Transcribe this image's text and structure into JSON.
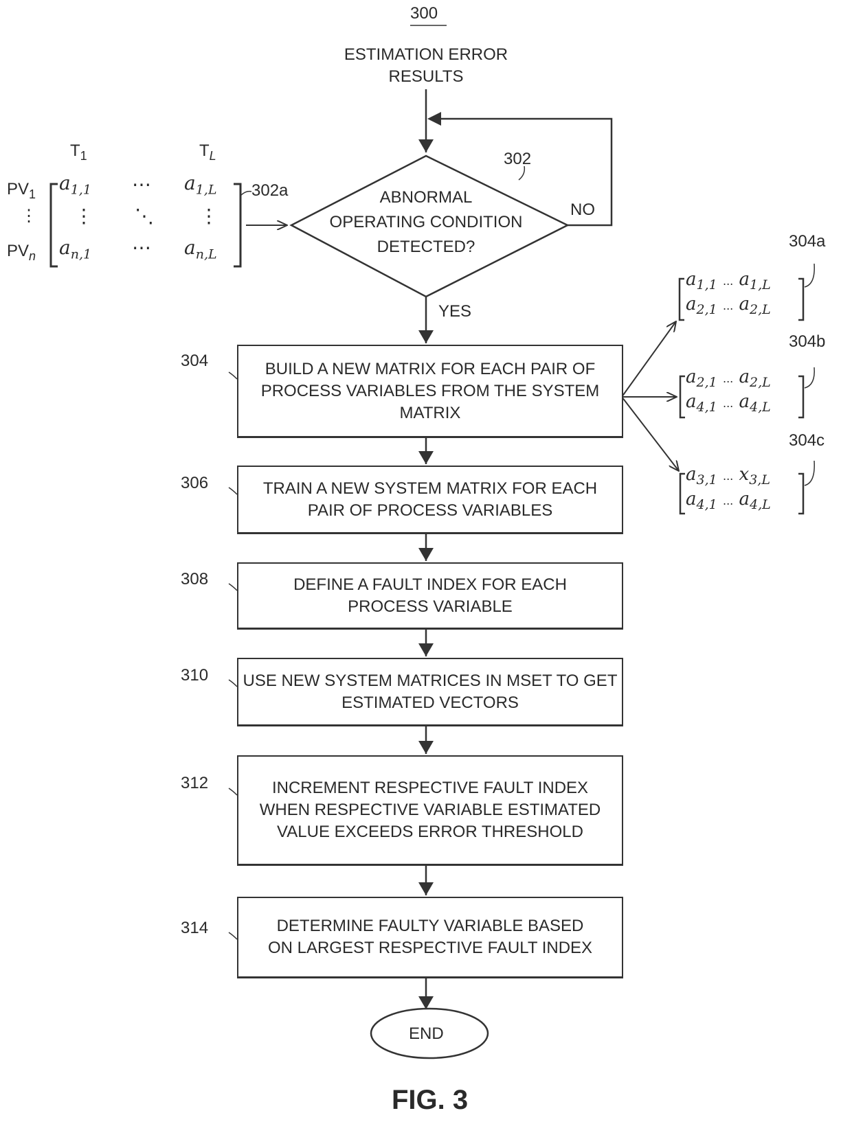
{
  "figure": {
    "ref_number": "300",
    "caption": "FIG. 3"
  },
  "start": {
    "label_line1": "ESTIMATION ERROR",
    "label_line2": "RESULTS"
  },
  "decision": {
    "ref": "302",
    "line1": "ABNORMAL",
    "line2": "OPERATING CONDITION",
    "line3": "DETECTED?",
    "no_label": "NO",
    "yes_label": "YES"
  },
  "system_matrix": {
    "ref": "302a",
    "col_first": "T",
    "col_first_sub": "1",
    "col_last": "T",
    "col_last_sub": "L",
    "row_first": "PV",
    "row_first_sub": "1",
    "row_dots": "⋮",
    "row_last": "PV",
    "row_last_sub": "n",
    "cells": {
      "top_left": "a",
      "top_left_sub": "1,1",
      "top_dots": "⋯",
      "top_right": "a",
      "top_right_sub": "1,L",
      "mid_left": "⋮",
      "mid_center": "⋱",
      "mid_right": "⋮",
      "bottom_left": "a",
      "bottom_left_sub": "n,1",
      "bottom_dots": "⋯",
      "bottom_right": "a",
      "bottom_right_sub": "n,L"
    }
  },
  "pair_matrices": [
    {
      "ref": "304a",
      "rows": [
        {
          "l": "a",
          "ls": "1,1",
          "r": "a",
          "rs": "1,L"
        },
        {
          "l": "a",
          "ls": "2,1",
          "r": "a",
          "rs": "2,L"
        }
      ]
    },
    {
      "ref": "304b",
      "rows": [
        {
          "l": "a",
          "ls": "2,1",
          "r": "a",
          "rs": "2,L"
        },
        {
          "l": "a",
          "ls": "4,1",
          "r": "a",
          "rs": "4,L"
        }
      ]
    },
    {
      "ref": "304c",
      "rows": [
        {
          "l": "a",
          "ls": "3,1",
          "r": "x",
          "rs": "3,L"
        },
        {
          "l": "a",
          "ls": "4,1",
          "r": "a",
          "rs": "4,L"
        }
      ]
    }
  ],
  "pair_dots": "...",
  "steps": [
    {
      "ref": "304",
      "text": "BUILD A NEW MATRIX FOR EACH PAIR OF PROCESS VARIABLES FROM THE SYSTEM MATRIX"
    },
    {
      "ref": "306",
      "text": "TRAIN A NEW SYSTEM MATRIX FOR EACH PAIR OF PROCESS VARIABLES"
    },
    {
      "ref": "308",
      "text": "DEFINE A FAULT INDEX FOR EACH PROCESS VARIABLE"
    },
    {
      "ref": "310",
      "text": "USE NEW SYSTEM MATRICES IN MSET TO GET ESTIMATED VECTORS"
    },
    {
      "ref": "312",
      "text": "INCREMENT RESPECTIVE FAULT INDEX WHEN RESPECTIVE VARIABLE ESTIMATED VALUE EXCEEDS ERROR THRESHOLD"
    },
    {
      "ref": "314",
      "text": "DETERMINE FAULTY VARIABLE BASED ON LARGEST RESPECTIVE FAULT INDEX"
    }
  ],
  "end": {
    "label": "END"
  }
}
